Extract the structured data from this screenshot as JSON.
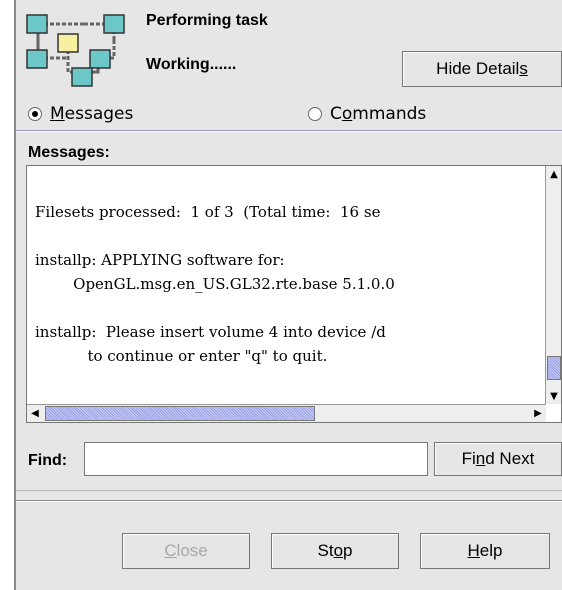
{
  "header": {
    "title": "Performing task",
    "status": "Working......",
    "hide_details_prefix": "Hide Detail",
    "hide_details_mnemonic": "s"
  },
  "tabs": {
    "messages_mnemonic": "M",
    "messages_rest": "essages",
    "commands_prefix": "C",
    "commands_mnemonic": "o",
    "commands_rest": "mmands",
    "selected": "messages"
  },
  "messages": {
    "label": "Messages:",
    "text": "\nFilesets processed:  1 of 3  (Total time:  16 se\n\ninstallp: APPLYING software for:\n        OpenGL.msg.en_US.GL32.rte.base 5.1.0.0\n\ninstallp:  Please insert volume 4 into device /d\n           to continue or enter \"q\" to quit.\n"
  },
  "find": {
    "label": "Find:",
    "value": "",
    "next_prefix": "Fi",
    "next_mnemonic": "n",
    "next_rest": "d Next"
  },
  "buttons": {
    "close_mnemonic": "C",
    "close_rest": "lose",
    "stop_prefix": "St",
    "stop_mnemonic": "o",
    "stop_rest": "p",
    "help_mnemonic": "H",
    "help_rest": "elp"
  },
  "colors": {
    "dialog_bg": "#e6e6e6",
    "scroll_thumb": "#9aa0e8",
    "separator_accent": "#9999cc"
  }
}
